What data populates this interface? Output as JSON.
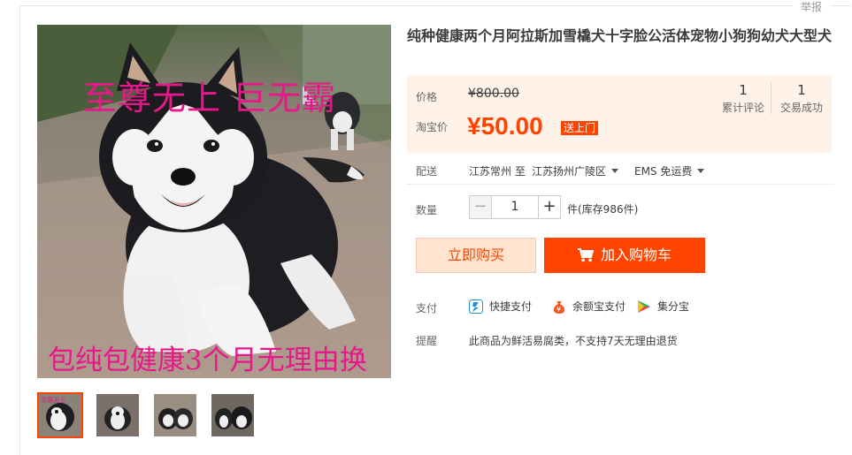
{
  "report_label": "举报",
  "product": {
    "title": "纯种健康两个月阿拉斯加雪橇犬十字脸公活体宠物小狗狗幼犬大型犬",
    "image_overlay_top": "至尊无上 巨无霸",
    "image_overlay_bottom": "包纯包健康3个月无理由换",
    "thumbnail_count": 4
  },
  "price": {
    "original_label": "价格",
    "original_value": "¥800.00",
    "promo_label": "淘宝价",
    "promo_value": "¥50.00",
    "promo_tag": "送上门"
  },
  "stats": [
    {
      "num": "1",
      "label": "累计评论"
    },
    {
      "num": "1",
      "label": "交易成功"
    }
  ],
  "shipping": {
    "label": "配送",
    "from": "江苏常州 至",
    "to": "江苏扬州广陵区",
    "method": "EMS 免运费"
  },
  "quantity": {
    "label": "数量",
    "value": "1",
    "minus": "−",
    "plus": "+",
    "stock": "件(库存986件)"
  },
  "actions": {
    "buy_now": "立即购买",
    "add_cart": "加入购物车"
  },
  "payment": {
    "label": "支付",
    "methods": [
      "快捷支付",
      "余额宝支付",
      "集分宝"
    ]
  },
  "notice": {
    "label": "提醒",
    "text": "此商品为鲜活易腐类，不支持7天无理由退货"
  },
  "colors": {
    "accent": "#ff4400",
    "price_bg": "#fff2e8",
    "overlay_text": "#e8178a"
  }
}
